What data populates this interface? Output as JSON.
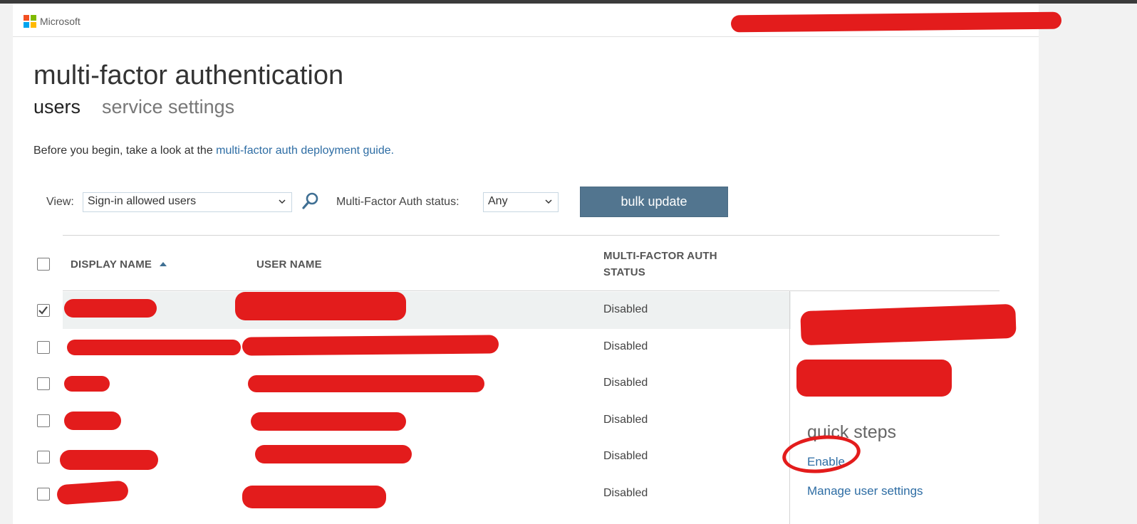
{
  "header": {
    "brand": "Microsoft"
  },
  "page": {
    "title": "multi-factor authentication",
    "tabs": [
      {
        "label": "users",
        "active": true
      },
      {
        "label": "service settings",
        "active": false
      }
    ],
    "intro_text": "Before you begin, take a look at the ",
    "intro_link": "multi-factor auth deployment guide."
  },
  "filters": {
    "view_label": "View:",
    "view_value": "Sign-in allowed users",
    "status_label": "Multi-Factor Auth status:",
    "status_value": "Any",
    "bulk_update_label": "bulk update"
  },
  "table": {
    "columns": {
      "display_name": "DISPLAY NAME",
      "user_name": "USER NAME",
      "mfa_status_line1": "MULTI-FACTOR AUTH",
      "mfa_status_line2": "STATUS"
    },
    "rows": [
      {
        "status": "Disabled",
        "checked": true
      },
      {
        "status": "Disabled",
        "checked": false
      },
      {
        "status": "Disabled",
        "checked": false
      },
      {
        "status": "Disabled",
        "checked": false
      },
      {
        "status": "Disabled",
        "checked": false
      },
      {
        "status": "Disabled",
        "checked": false
      }
    ]
  },
  "side_panel": {
    "quick_steps_title": "quick steps",
    "enable_label": "Enable",
    "manage_label": "Manage user settings"
  },
  "colors": {
    "accent_button": "#52758f",
    "link": "#2e6da4",
    "redaction": "#e31c1c"
  }
}
